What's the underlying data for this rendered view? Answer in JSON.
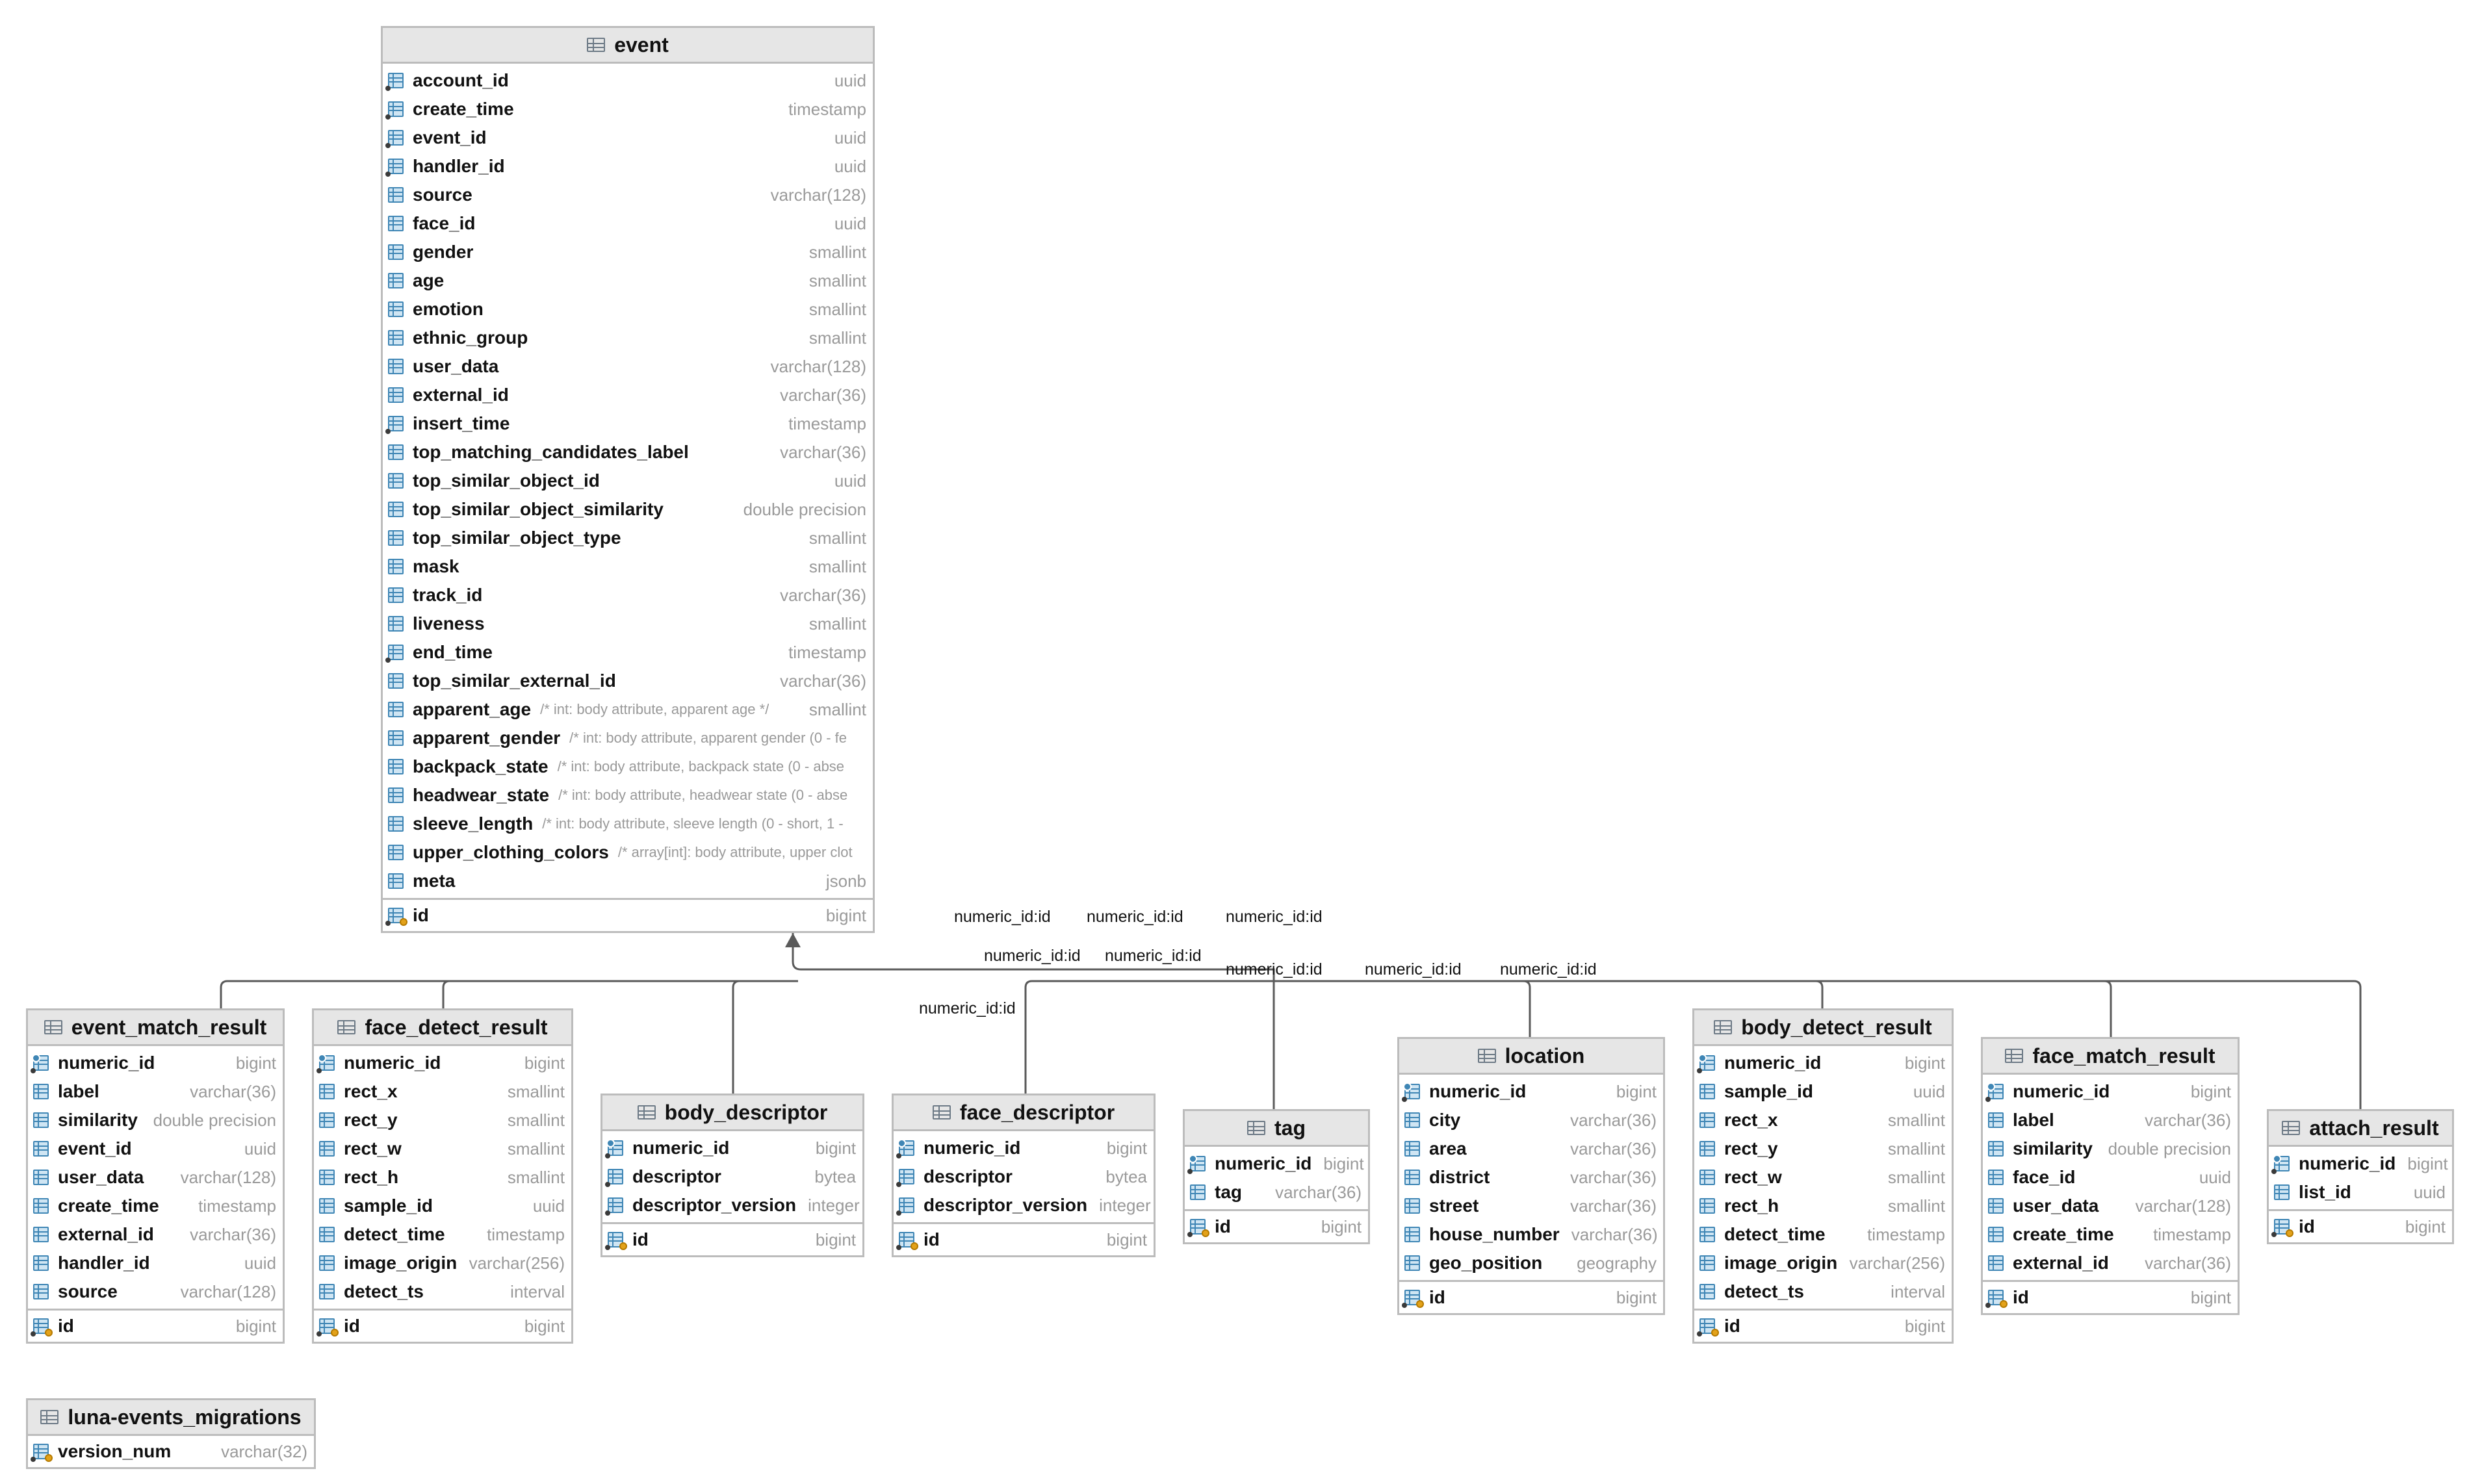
{
  "tables": {
    "event": {
      "name": "event",
      "columns": [
        {
          "name": "account_id",
          "type": "uuid",
          "icon": "column-index-icon"
        },
        {
          "name": "create_time",
          "type": "timestamp",
          "icon": "column-index-icon"
        },
        {
          "name": "event_id",
          "type": "uuid",
          "icon": "column-index-icon"
        },
        {
          "name": "handler_id",
          "type": "uuid",
          "icon": "column-index-icon"
        },
        {
          "name": "source",
          "type": "varchar(128)",
          "icon": "column-icon"
        },
        {
          "name": "face_id",
          "type": "uuid",
          "icon": "column-icon"
        },
        {
          "name": "gender",
          "type": "smallint",
          "icon": "column-icon"
        },
        {
          "name": "age",
          "type": "smallint",
          "icon": "column-icon"
        },
        {
          "name": "emotion",
          "type": "smallint",
          "icon": "column-icon"
        },
        {
          "name": "ethnic_group",
          "type": "smallint",
          "icon": "column-icon"
        },
        {
          "name": "user_data",
          "type": "varchar(128)",
          "icon": "column-icon"
        },
        {
          "name": "external_id",
          "type": "varchar(36)",
          "icon": "column-icon"
        },
        {
          "name": "insert_time",
          "type": "timestamp",
          "icon": "column-index-icon"
        },
        {
          "name": "top_matching_candidates_label",
          "type": "varchar(36)",
          "icon": "column-icon"
        },
        {
          "name": "top_similar_object_id",
          "type": "uuid",
          "icon": "column-icon"
        },
        {
          "name": "top_similar_object_similarity",
          "type": "double precision",
          "icon": "column-icon"
        },
        {
          "name": "top_similar_object_type",
          "type": "smallint",
          "icon": "column-icon"
        },
        {
          "name": "mask",
          "type": "smallint",
          "icon": "column-icon"
        },
        {
          "name": "track_id",
          "type": "varchar(36)",
          "icon": "column-icon"
        },
        {
          "name": "liveness",
          "type": "smallint",
          "icon": "column-icon"
        },
        {
          "name": "end_time",
          "type": "timestamp",
          "icon": "column-index-icon"
        },
        {
          "name": "top_similar_external_id",
          "type": "varchar(36)",
          "icon": "column-icon"
        },
        {
          "name": "apparent_age",
          "comment": "/* int: body attribute, apparent age */",
          "type": "smallint",
          "icon": "column-icon"
        },
        {
          "name": "apparent_gender",
          "comment": "/* int: body attribute, apparent gender (0 - fe",
          "type": "",
          "icon": "column-icon"
        },
        {
          "name": "backpack_state",
          "comment": "/* int: body attribute, backpack state (0 - abse",
          "type": "",
          "icon": "column-icon"
        },
        {
          "name": "headwear_state",
          "comment": "/* int: body attribute, headwear state (0 - abse",
          "type": "",
          "icon": "column-icon"
        },
        {
          "name": "sleeve_length",
          "comment": "/* int: body attribute, sleeve length (0 - short, 1 -",
          "type": "",
          "icon": "column-icon"
        },
        {
          "name": "upper_clothing_colors",
          "comment": "/* array[int]: body attribute, upper clot",
          "type": "",
          "icon": "column-icon"
        },
        {
          "name": "meta",
          "type": "jsonb",
          "icon": "column-icon"
        }
      ],
      "pk": [
        {
          "name": "id",
          "type": "bigint",
          "icon": "primary-key-icon"
        }
      ]
    },
    "event_match_result": {
      "name": "event_match_result",
      "columns": [
        {
          "name": "numeric_id",
          "type": "bigint",
          "icon": "foreign-key-icon"
        },
        {
          "name": "label",
          "type": "varchar(36)",
          "icon": "column-icon"
        },
        {
          "name": "similarity",
          "type": "double precision",
          "icon": "column-icon"
        },
        {
          "name": "event_id",
          "type": "uuid",
          "icon": "column-icon"
        },
        {
          "name": "user_data",
          "type": "varchar(128)",
          "icon": "column-icon"
        },
        {
          "name": "create_time",
          "type": "timestamp",
          "icon": "column-icon"
        },
        {
          "name": "external_id",
          "type": "varchar(36)",
          "icon": "column-icon"
        },
        {
          "name": "handler_id",
          "type": "uuid",
          "icon": "column-icon"
        },
        {
          "name": "source",
          "type": "varchar(128)",
          "icon": "column-icon"
        }
      ],
      "pk": [
        {
          "name": "id",
          "type": "bigint",
          "icon": "primary-key-icon"
        }
      ]
    },
    "face_detect_result": {
      "name": "face_detect_result",
      "columns": [
        {
          "name": "numeric_id",
          "type": "bigint",
          "icon": "foreign-key-icon"
        },
        {
          "name": "rect_x",
          "type": "smallint",
          "icon": "column-icon"
        },
        {
          "name": "rect_y",
          "type": "smallint",
          "icon": "column-icon"
        },
        {
          "name": "rect_w",
          "type": "smallint",
          "icon": "column-icon"
        },
        {
          "name": "rect_h",
          "type": "smallint",
          "icon": "column-icon"
        },
        {
          "name": "sample_id",
          "type": "uuid",
          "icon": "column-icon"
        },
        {
          "name": "detect_time",
          "type": "timestamp",
          "icon": "column-icon"
        },
        {
          "name": "image_origin",
          "type": "varchar(256)",
          "icon": "column-icon"
        },
        {
          "name": "detect_ts",
          "type": "interval",
          "icon": "column-icon"
        }
      ],
      "pk": [
        {
          "name": "id",
          "type": "bigint",
          "icon": "primary-key-icon"
        }
      ]
    },
    "body_descriptor": {
      "name": "body_descriptor",
      "columns": [
        {
          "name": "numeric_id",
          "type": "bigint",
          "icon": "foreign-key-icon"
        },
        {
          "name": "descriptor",
          "type": "bytea",
          "icon": "column-index-icon"
        },
        {
          "name": "descriptor_version",
          "type": "integer",
          "icon": "column-index-icon"
        }
      ],
      "pk": [
        {
          "name": "id",
          "type": "bigint",
          "icon": "primary-key-icon"
        }
      ]
    },
    "face_descriptor": {
      "name": "face_descriptor",
      "columns": [
        {
          "name": "numeric_id",
          "type": "bigint",
          "icon": "foreign-key-icon"
        },
        {
          "name": "descriptor",
          "type": "bytea",
          "icon": "column-index-icon"
        },
        {
          "name": "descriptor_version",
          "type": "integer",
          "icon": "column-index-icon"
        }
      ],
      "pk": [
        {
          "name": "id",
          "type": "bigint",
          "icon": "primary-key-icon"
        }
      ]
    },
    "tag": {
      "name": "tag",
      "columns": [
        {
          "name": "numeric_id",
          "type": "bigint",
          "icon": "foreign-key-icon"
        },
        {
          "name": "tag",
          "type": "varchar(36)",
          "icon": "column-icon"
        }
      ],
      "pk": [
        {
          "name": "id",
          "type": "bigint",
          "icon": "primary-key-icon"
        }
      ]
    },
    "location": {
      "name": "location",
      "columns": [
        {
          "name": "numeric_id",
          "type": "bigint",
          "icon": "foreign-key-icon"
        },
        {
          "name": "city",
          "type": "varchar(36)",
          "icon": "column-icon"
        },
        {
          "name": "area",
          "type": "varchar(36)",
          "icon": "column-icon"
        },
        {
          "name": "district",
          "type": "varchar(36)",
          "icon": "column-icon"
        },
        {
          "name": "street",
          "type": "varchar(36)",
          "icon": "column-icon"
        },
        {
          "name": "house_number",
          "type": "varchar(36)",
          "icon": "column-icon"
        },
        {
          "name": "geo_position",
          "type": "geography",
          "icon": "column-icon"
        }
      ],
      "pk": [
        {
          "name": "id",
          "type": "bigint",
          "icon": "primary-key-icon"
        }
      ]
    },
    "body_detect_result": {
      "name": "body_detect_result",
      "columns": [
        {
          "name": "numeric_id",
          "type": "bigint",
          "icon": "foreign-key-icon"
        },
        {
          "name": "sample_id",
          "type": "uuid",
          "icon": "column-icon"
        },
        {
          "name": "rect_x",
          "type": "smallint",
          "icon": "column-icon"
        },
        {
          "name": "rect_y",
          "type": "smallint",
          "icon": "column-icon"
        },
        {
          "name": "rect_w",
          "type": "smallint",
          "icon": "column-icon"
        },
        {
          "name": "rect_h",
          "type": "smallint",
          "icon": "column-icon"
        },
        {
          "name": "detect_time",
          "type": "timestamp",
          "icon": "column-icon"
        },
        {
          "name": "image_origin",
          "type": "varchar(256)",
          "icon": "column-icon"
        },
        {
          "name": "detect_ts",
          "type": "interval",
          "icon": "column-icon"
        }
      ],
      "pk": [
        {
          "name": "id",
          "type": "bigint",
          "icon": "primary-key-icon"
        }
      ]
    },
    "face_match_result": {
      "name": "face_match_result",
      "columns": [
        {
          "name": "numeric_id",
          "type": "bigint",
          "icon": "foreign-key-icon"
        },
        {
          "name": "label",
          "type": "varchar(36)",
          "icon": "column-icon"
        },
        {
          "name": "similarity",
          "type": "double precision",
          "icon": "column-icon"
        },
        {
          "name": "face_id",
          "type": "uuid",
          "icon": "column-icon"
        },
        {
          "name": "user_data",
          "type": "varchar(128)",
          "icon": "column-icon"
        },
        {
          "name": "create_time",
          "type": "timestamp",
          "icon": "column-icon"
        },
        {
          "name": "external_id",
          "type": "varchar(36)",
          "icon": "column-icon"
        }
      ],
      "pk": [
        {
          "name": "id",
          "type": "bigint",
          "icon": "primary-key-icon"
        }
      ]
    },
    "attach_result": {
      "name": "attach_result",
      "columns": [
        {
          "name": "numeric_id",
          "type": "bigint",
          "icon": "foreign-key-icon"
        },
        {
          "name": "list_id",
          "type": "uuid",
          "icon": "column-icon"
        }
      ],
      "pk": [
        {
          "name": "id",
          "type": "bigint",
          "icon": "primary-key-icon"
        }
      ]
    },
    "luna_events_migrations": {
      "name": "luna-events_migrations",
      "columns": [],
      "pk": [
        {
          "name": "version_num",
          "type": "varchar(32)",
          "icon": "primary-key-icon"
        }
      ]
    }
  },
  "connector_labels": [
    "numeric_id:id",
    "numeric_id:id",
    "numeric_id:id",
    "numeric_id:id",
    "numeric_id:id",
    "numeric_id:id",
    "numeric_id:id",
    "numeric_id:id",
    "numeric_id:id",
    "numeric_id:id"
  ]
}
